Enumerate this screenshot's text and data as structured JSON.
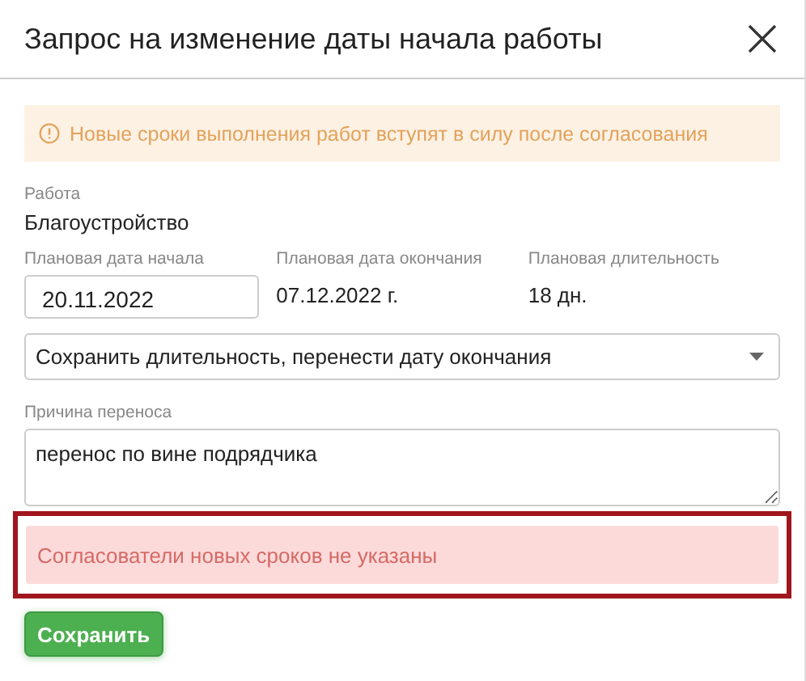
{
  "dialog": {
    "title": "Запрос на изменение даты начала работы"
  },
  "notice": {
    "text": "Новые сроки выполнения работ вступят в силу после согласования"
  },
  "work": {
    "label": "Работа",
    "value": "Благоустройство"
  },
  "dates": [
    {
      "kind": "input",
      "label": "Плановая дата начала",
      "value": "20.11.2022"
    },
    {
      "kind": "text",
      "label": "Плановая дата окончания",
      "value": "07.12.2022 г."
    },
    {
      "kind": "text",
      "label": "Плановая длительность",
      "value": "18 дн."
    }
  ],
  "mode_select": {
    "value": "Сохранить длительность, перенести дату окончания"
  },
  "reason": {
    "label": "Причина переноса",
    "value": "перенос по вине подрядчика"
  },
  "error": {
    "text": "Согласователи новых сроков не указаны",
    "highlighted": true
  },
  "buttons": [
    {
      "label": "Сохранить"
    }
  ]
}
